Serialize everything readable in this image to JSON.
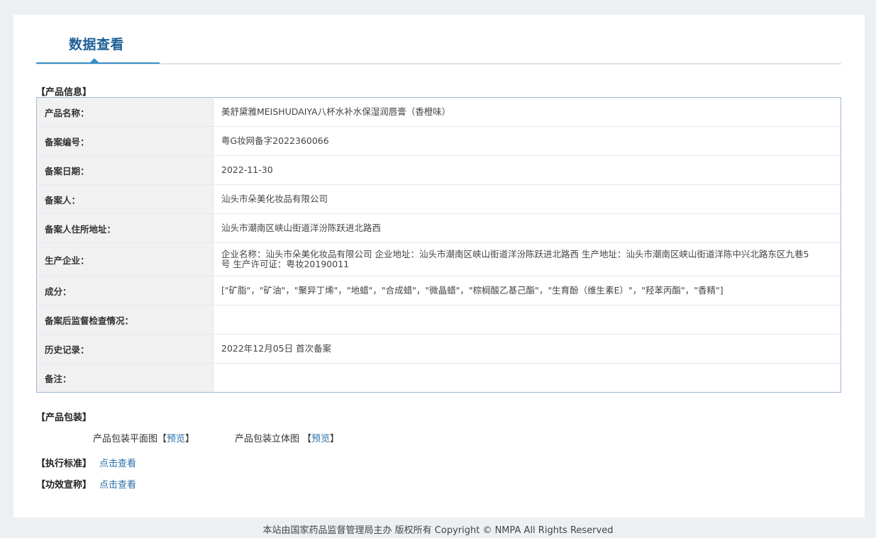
{
  "page": {
    "tab_title": "数据查看"
  },
  "product_info": {
    "section_label": "【产品信息】",
    "rows": [
      {
        "label": "产品名称：",
        "value": "美舒黛雅MEISHUDAIYA八杯水补水保湿润唇膏（香橙味）"
      },
      {
        "label": "备案编号：",
        "value": "粤G妆网备字2022360066"
      },
      {
        "label": "备案日期：",
        "value": "2022-11-30"
      },
      {
        "label": "备案人：",
        "value": "汕头市朵美化妆品有限公司"
      },
      {
        "label": "备案人住所地址：",
        "value": "汕头市潮南区峡山街道洋汾陈跃进北路西"
      },
      {
        "label": "生产企业：",
        "value": "企业名称：汕头市朵美化妆品有限公司 企业地址：汕头市潮南区峡山街道洋汾陈跃进北路西 生产地址：汕头市潮南区峡山街道洋陈中兴北路东区九巷5号 生产许可证：粤妆20190011"
      },
      {
        "label": "成分：",
        "value": "[\"矿脂\"，\"矿油\"，\"聚异丁烯\"，\"地蜡\"，\"合成蜡\"，\"微晶蜡\"，\"棕榈酸乙基己酯\"，\"生育酚（维生素E）\"，\"羟苯丙酯\"，\"香精\"]"
      },
      {
        "label": "备案后监督检查情况：",
        "value": ""
      },
      {
        "label": "历史记录：",
        "value": "2022年12月05日 首次备案"
      },
      {
        "label": "备注：",
        "value": ""
      }
    ]
  },
  "packaging": {
    "section_label": "【产品包装】",
    "flat_label": "产品包装平面图【",
    "flat_link": "预览",
    "flat_close": "】",
    "three_d_label": "产品包装立体图 【",
    "three_d_link": "预览",
    "three_d_close": "】"
  },
  "standard": {
    "section_label": "【执行标准】",
    "link": "点击查看"
  },
  "efficacy": {
    "section_label": "【功效宣称】",
    "link": "点击查看"
  },
  "footer": {
    "text": "本站由国家药品监督管理局主办 版权所有 Copyright © NMPA All Rights Reserved"
  }
}
